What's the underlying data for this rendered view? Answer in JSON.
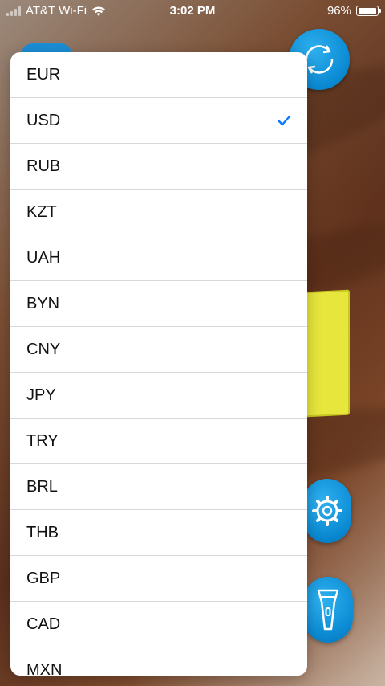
{
  "status_bar": {
    "carrier": "AT&T Wi-Fi",
    "time": "3:02 PM",
    "battery_percent": "96%",
    "battery_level": 0.96
  },
  "currency_picker": {
    "selected": "USD",
    "options": [
      "EUR",
      "USD",
      "RUB",
      "KZT",
      "UAH",
      "BYN",
      "CNY",
      "JPY",
      "TRY",
      "BRL",
      "THB",
      "GBP",
      "CAD",
      "MXN"
    ]
  },
  "icons": {
    "refresh": "refresh-icon",
    "settings": "gear-icon",
    "flashlight": "flashlight-icon",
    "checkmark": "checkmark-icon"
  },
  "colors": {
    "accent": "#0a89d2",
    "check": "#0a7aff"
  }
}
